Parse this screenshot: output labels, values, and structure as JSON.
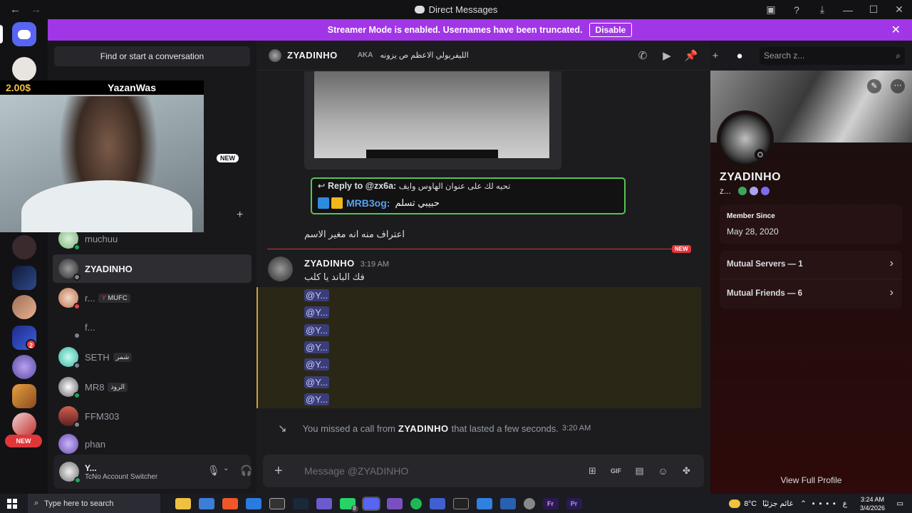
{
  "window": {
    "title": "Direct Messages"
  },
  "streamer_banner": {
    "text": "Streamer Mode is enabled. Usernames have been truncated.",
    "disable_label": "Disable"
  },
  "sidebar": {
    "search_placeholder": "Find or start a conversation",
    "overlay_text": "YazanWas",
    "overlay_amount": "2.00$",
    "new_pill": "NEW",
    "dms": [
      {
        "name": "muchuu",
        "status": "online"
      },
      {
        "name": "ZYADINHO",
        "status": "offline",
        "selected": true
      },
      {
        "name": "r...",
        "tag": "MUFC",
        "status": "dnd"
      },
      {
        "name": "f...",
        "status": "offline"
      },
      {
        "name": "SETH",
        "tag": "شمر",
        "status": "offline"
      },
      {
        "name": "MR8",
        "tag": "الرود",
        "status": "online"
      },
      {
        "name": "FFM303",
        "status": "offline"
      },
      {
        "name": "phan",
        "status": "offline"
      }
    ],
    "guild_new_label": "NEW",
    "guild_badge": "2",
    "user": {
      "name": "Y...",
      "status_text": "TcNo Account Switcher"
    }
  },
  "chat": {
    "recipient": "ZYADINHO",
    "aka_label": "AKA",
    "aka_value": "الليفربولي الاعظم ص يزونه",
    "search_placeholder": "Search z...",
    "reply": {
      "prefix": "Reply to",
      "to": "@zx6a:",
      "quote": "تحيه لك على عنوان الهاوس وايف",
      "author": "MRB3og:",
      "text": "حبيبي تسلم"
    },
    "msg1": "اعتراف منه انه مغير الاسم",
    "new_label": "NEW",
    "msg2": {
      "author": "ZYADINHO",
      "time": "3:19 AM",
      "text": "فك الباند يا كلب",
      "mentions": [
        "@Y...",
        "@Y...",
        "@Y...",
        "@Y...",
        "@Y...",
        "@Y...",
        "@Y..."
      ]
    },
    "missed_call": {
      "prefix": "You missed a call from",
      "name": "ZYADINHO",
      "suffix": "that lasted a few seconds.",
      "time": "3:20 AM"
    },
    "composer_placeholder": "Message @ZYADINHO"
  },
  "profile": {
    "name": "ZYADINHO",
    "sub": "z...",
    "member_since_label": "Member Since",
    "member_since": "May 28, 2020",
    "mutual_servers": "Mutual Servers — 1",
    "mutual_friends": "Mutual Friends — 6",
    "view_full": "View Full Profile"
  },
  "taskbar": {
    "search": "Type here to search",
    "weather": "8°C",
    "weather_text": "غائم جزئيًا",
    "lang": "ع",
    "time": "3:24 AM",
    "date": "3/4/2026",
    "badge": "8"
  },
  "colors": {
    "blurple": "#5865f2",
    "streamer": "#a136e6",
    "online": "#23a55a",
    "dnd": "#f23f43",
    "mention_bg": "#3a3d78",
    "new_red": "#e0363a"
  }
}
